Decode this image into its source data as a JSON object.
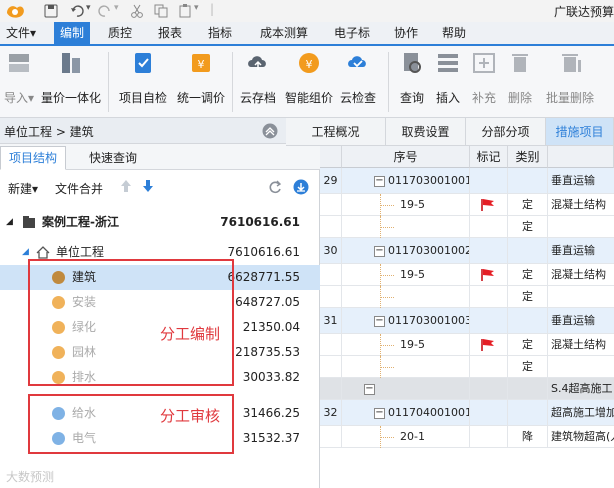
{
  "window": {
    "title_right": "广联达预算"
  },
  "menu": [
    {
      "label": "文件▾"
    },
    {
      "label": "编制"
    },
    {
      "label": "质控"
    },
    {
      "label": "报表"
    },
    {
      "label": "指标"
    },
    {
      "label": "成本测算"
    },
    {
      "label": "电子标"
    },
    {
      "label": "协作"
    },
    {
      "label": "帮助"
    }
  ],
  "ribbon": [
    {
      "label": "导入▾",
      "icon": "import-icon",
      "color": "#9aa0a6"
    },
    {
      "label": "量价一体化",
      "icon": "integration-icon",
      "color": "#6b7a8c"
    },
    {
      "label": "项目自检",
      "icon": "self-check-icon",
      "color": "#2d7fd8"
    },
    {
      "label": "统一调价",
      "icon": "adjust-price-icon",
      "color": "#f29b1e"
    },
    {
      "label": "云存档",
      "icon": "cloud-archive-icon",
      "color": "#5a6470"
    },
    {
      "label": "智能组价",
      "icon": "smart-pricing-icon",
      "color": "#f29b1e"
    },
    {
      "label": "云检查",
      "icon": "cloud-check-icon",
      "color": "#2d7fd8"
    },
    {
      "label": "查询",
      "icon": "query-icon",
      "color": "#8a9099"
    },
    {
      "label": "插入",
      "icon": "insert-icon",
      "color": "#8a9099"
    },
    {
      "label": "补充",
      "icon": "supplement-icon",
      "color": "#b0b4ba"
    },
    {
      "label": "删除",
      "icon": "delete-icon",
      "color": "#b0b4ba"
    },
    {
      "label": "批量删除",
      "icon": "batch-delete-icon",
      "color": "#b0b4ba"
    }
  ],
  "left": {
    "breadcrumb": "单位工程 > 建筑",
    "tabs": [
      {
        "label": "项目结构"
      },
      {
        "label": "快速查询"
      }
    ],
    "toolbar": {
      "new": "新建▾",
      "merge": "文件合并"
    },
    "root": {
      "name": "案例工程-浙江",
      "value": "7610616.61"
    },
    "unit": {
      "name": "单位工程",
      "value": "7610616.61"
    },
    "items": [
      {
        "name": "建筑",
        "value": "6628771.55",
        "icon_color": "#c08a3e"
      },
      {
        "name": "安装",
        "value": "648727.05",
        "icon_color": "#f0b25a"
      },
      {
        "name": "绿化",
        "value": "21350.04",
        "icon_color": "#f0b25a"
      },
      {
        "name": "园林",
        "value": "218735.53",
        "icon_color": "#f0b25a"
      },
      {
        "name": "排水",
        "value": "30033.82",
        "icon_color": "#f0b25a"
      },
      {
        "name": "给水",
        "value": "31466.25",
        "icon_color": "#7fb2e5"
      },
      {
        "name": "电气",
        "value": "31532.37",
        "icon_color": "#7fb2e5"
      }
    ],
    "annotations": {
      "edit": "分工编制",
      "review": "分工审核"
    },
    "watermark": "大数预测"
  },
  "right": {
    "tabs": [
      {
        "label": "工程概况"
      },
      {
        "label": "取费设置"
      },
      {
        "label": "分部分项"
      },
      {
        "label": "措施项目"
      }
    ],
    "columns": {
      "seq": "序号",
      "mark": "标记",
      "category": "类别",
      "name": ""
    },
    "rows": [
      {
        "kind": "item",
        "num": "29",
        "code": "011703001001",
        "mark": "",
        "cat": "",
        "name": "垂直运输"
      },
      {
        "kind": "sub",
        "num": "",
        "code": "19-5",
        "mark": "flag",
        "cat": "定",
        "name": "混凝土结构"
      },
      {
        "kind": "sub",
        "num": "",
        "code": "",
        "mark": "",
        "cat": "定",
        "name": ""
      },
      {
        "kind": "item",
        "num": "30",
        "code": "011703001002",
        "mark": "",
        "cat": "",
        "name": "垂直运输"
      },
      {
        "kind": "sub",
        "num": "",
        "code": "19-5",
        "mark": "flag",
        "cat": "定",
        "name": "混凝土结构"
      },
      {
        "kind": "sub",
        "num": "",
        "code": "",
        "mark": "",
        "cat": "定",
        "name": ""
      },
      {
        "kind": "item",
        "num": "31",
        "code": "011703001003",
        "mark": "",
        "cat": "",
        "name": "垂直运输"
      },
      {
        "kind": "sub",
        "num": "",
        "code": "19-5",
        "mark": "flag",
        "cat": "定",
        "name": "混凝土结构"
      },
      {
        "kind": "sub",
        "num": "",
        "code": "",
        "mark": "",
        "cat": "定",
        "name": ""
      },
      {
        "kind": "group",
        "num": "",
        "code": "",
        "mark": "",
        "cat": "",
        "name": "S.4超高施工"
      },
      {
        "kind": "item",
        "num": "32",
        "code": "011704001001",
        "mark": "",
        "cat": "",
        "name": "超高施工增加"
      },
      {
        "kind": "sub",
        "num": "",
        "code": "20-1",
        "mark": "",
        "cat": "降",
        "name": "建筑物超高(人工某价临"
      }
    ]
  }
}
